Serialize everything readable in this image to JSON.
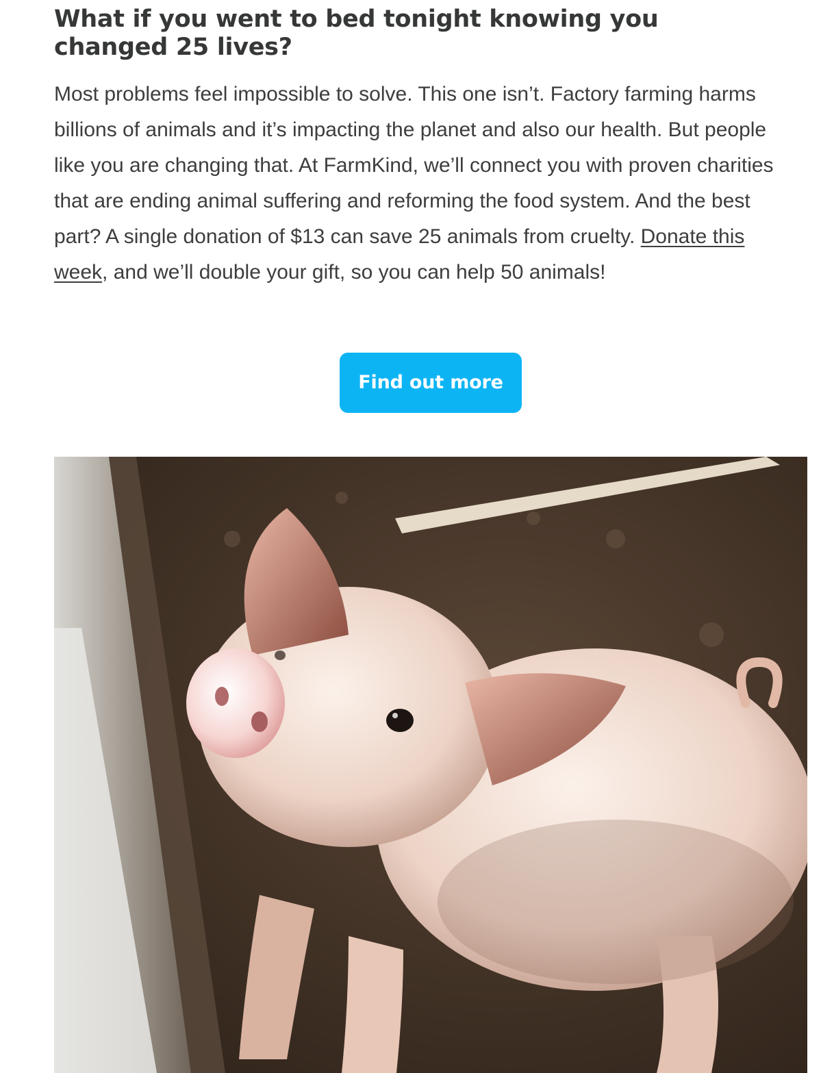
{
  "article": {
    "headline": "What if you went to bed tonight knowing you changed 25 lives?",
    "paragraph_before_link": "Most problems feel impossible to solve. This one isn’t. Factory farming harms billions of animals and it’s impacting the planet and also our health. But people like you are changing that. At FarmKind, we’ll connect you with proven charities that are ending animal suffering and reforming the food system. And the best part? A single donation of $13 can save 25 animals from cruelty. ",
    "link_text": "Donate this week",
    "paragraph_after_link": ", and we’ll double your gift, so you can help 50 animals!"
  },
  "cta": {
    "label": "Find out more",
    "color": "#0db4f4"
  },
  "image": {
    "subject": "piglet-photo"
  }
}
